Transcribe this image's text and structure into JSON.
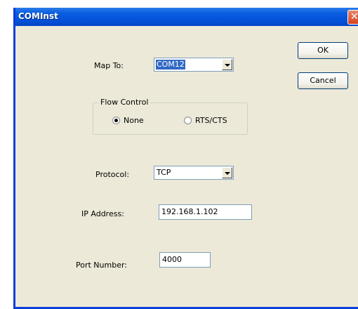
{
  "window": {
    "title": "COMInst",
    "close_glyph": "✕"
  },
  "buttons": {
    "ok_label": "OK",
    "cancel_label": "Cancel"
  },
  "map_to": {
    "label": "Map To:",
    "value": "COM12"
  },
  "flow_control": {
    "title": "Flow Control",
    "options": [
      {
        "label": "None",
        "selected": true
      },
      {
        "label": "RTS/CTS",
        "selected": false
      }
    ]
  },
  "protocol": {
    "label": "Protocol:",
    "value": "TCP"
  },
  "ip_address": {
    "label": "IP Address:",
    "value": "192.168.1.102"
  },
  "port_number": {
    "label": "Port Number:",
    "value": "4000"
  },
  "colors": {
    "titlebar": "#0a5de0",
    "dialog_bg": "#ece9d8",
    "selection": "#316ac5",
    "close": "#d4401d"
  },
  "icons": {
    "close": "close-icon",
    "dropdown": "chevron-down-icon",
    "radio": "radio-icon"
  }
}
